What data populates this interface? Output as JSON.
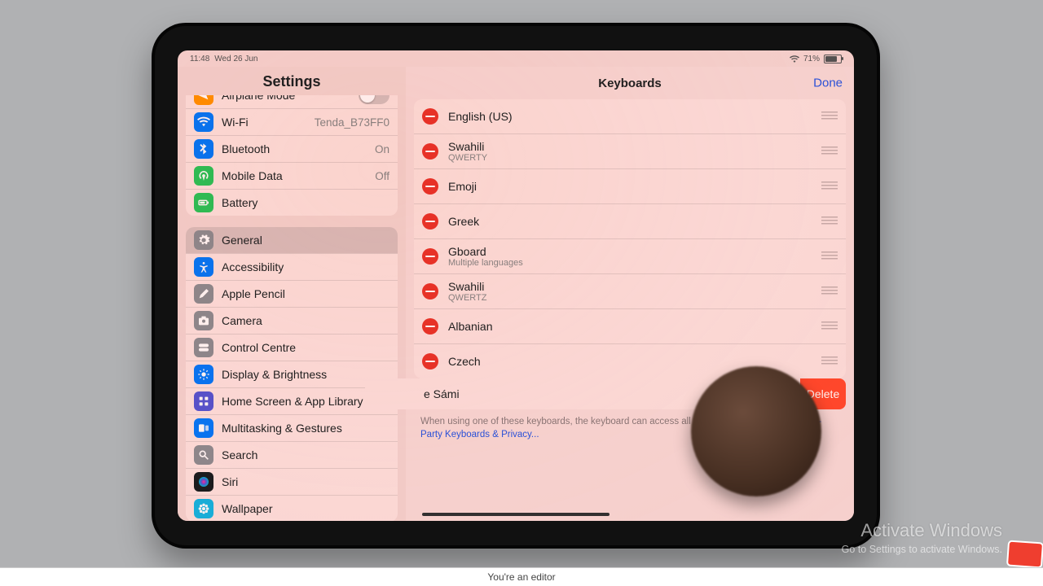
{
  "status": {
    "time": "11:48",
    "date": "Wed 26 Jun",
    "battery_pct": "71%",
    "wifi_icon": "wifi"
  },
  "left": {
    "title": "Settings",
    "group1": [
      {
        "icon": "airplane",
        "color": "#ff9500",
        "label": "Airplane Mode",
        "toggle": true
      },
      {
        "icon": "wifi",
        "color": "#0a7aff",
        "label": "Wi-Fi",
        "value": "Tenda_B73FF0"
      },
      {
        "icon": "bluetooth",
        "color": "#0a7aff",
        "label": "Bluetooth",
        "value": "On"
      },
      {
        "icon": "antenna",
        "color": "#30c759",
        "label": "Mobile Data",
        "value": "Off"
      },
      {
        "icon": "battery",
        "color": "#30c759",
        "label": "Battery"
      }
    ],
    "group2": [
      {
        "icon": "gear",
        "color": "#8e8e93",
        "label": "General",
        "selected": true
      },
      {
        "icon": "access",
        "color": "#0a7aff",
        "label": "Accessibility"
      },
      {
        "icon": "pencil",
        "color": "#8e8e93",
        "label": "Apple Pencil"
      },
      {
        "icon": "camera",
        "color": "#8e8e93",
        "label": "Camera"
      },
      {
        "icon": "toggles",
        "color": "#8e8e93",
        "label": "Control Centre"
      },
      {
        "icon": "sun",
        "color": "#0a7aff",
        "label": "Display & Brightness"
      },
      {
        "icon": "grid",
        "color": "#5856d6",
        "label": "Home Screen & App Library"
      },
      {
        "icon": "stack",
        "color": "#0a7aff",
        "label": "Multitasking & Gestures"
      },
      {
        "icon": "search",
        "color": "#8e8e93",
        "label": "Search"
      },
      {
        "icon": "siri",
        "color": "#1c1c1e",
        "label": "Siri"
      },
      {
        "icon": "flower",
        "color": "#19b8e6",
        "label": "Wallpaper"
      }
    ]
  },
  "right": {
    "title": "Keyboards",
    "done_label": "Done",
    "rows": [
      {
        "label": "English (US)"
      },
      {
        "label": "Swahili",
        "sub": "QWERTY"
      },
      {
        "label": "Emoji"
      },
      {
        "label": "Greek"
      },
      {
        "label": "Gboard",
        "sub": "Multiple languages"
      },
      {
        "label": "Swahili",
        "sub": "QWERTZ"
      },
      {
        "label": "Albanian"
      },
      {
        "label": "Czech"
      }
    ],
    "slid_label": "e Sámi",
    "delete_label": "Delete",
    "footer_text": "When using one of these keyboards, the keyboard can access all the data you type. ",
    "footer_link": "About Third-Party Keyboards & Privacy..."
  },
  "overlay": {
    "watermark_title": "Activate Windows",
    "watermark_sub": "Go to Settings to activate Windows.",
    "editor_bar": "You're an editor"
  }
}
